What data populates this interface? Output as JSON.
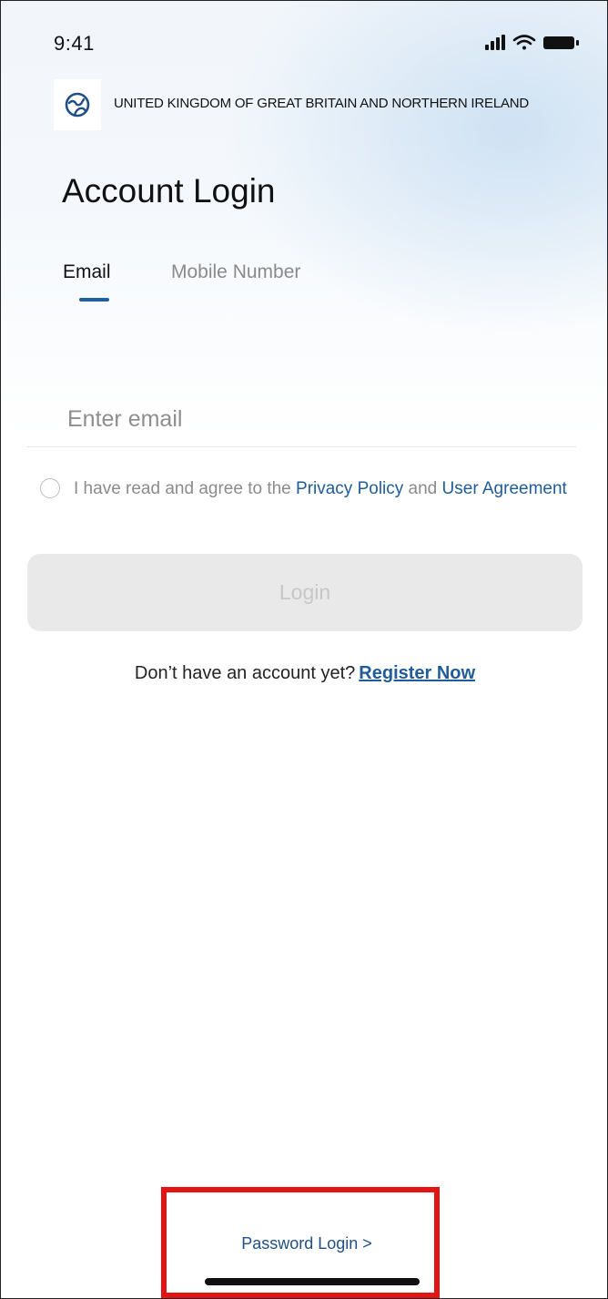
{
  "status_bar": {
    "time": "9:41",
    "icons": [
      "cellular-signal-icon",
      "wifi-icon",
      "battery-icon"
    ]
  },
  "region": {
    "icon": "globe-icon",
    "label": "UNITED KINGDOM OF GREAT BRITAIN AND NORTHERN IRELAND"
  },
  "page": {
    "title": "Account Login"
  },
  "tabs": [
    {
      "label": "Email",
      "active": true
    },
    {
      "label": "Mobile Number",
      "active": false
    }
  ],
  "email_field": {
    "placeholder": "Enter email",
    "value": ""
  },
  "agreement": {
    "checked": false,
    "prefix": "I have read and agree to the ",
    "privacy_link": "Privacy Policy",
    "middle": " and ",
    "user_agreement_link": "User Agreement"
  },
  "login_button": {
    "label": "Login",
    "enabled": false
  },
  "register": {
    "prompt": "Don’t have an account yet?",
    "link": "Register Now"
  },
  "footer": {
    "password_login": "Password Login >"
  },
  "colors": {
    "accent": "#1f5fa8",
    "link": "#1f5c99",
    "highlight": "#e21414",
    "button_disabled_bg": "#e9e9e9"
  }
}
